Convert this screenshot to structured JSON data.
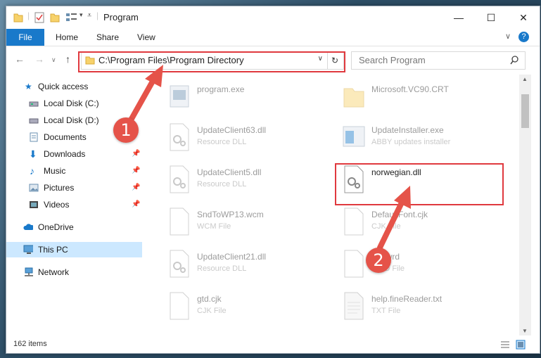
{
  "window": {
    "title": "Program"
  },
  "ribbon": {
    "tabs": [
      "File",
      "Home",
      "Share",
      "View"
    ]
  },
  "address": {
    "path": "C:\\Program Files\\Program Directory"
  },
  "search": {
    "placeholder": "Search Program"
  },
  "sidebar": {
    "items": [
      {
        "label": "Quick access",
        "icon": "star-icon"
      },
      {
        "label": "Local Disk (C:)",
        "icon": "drive-icon"
      },
      {
        "label": "Local Disk (D:)",
        "icon": "drive-icon"
      },
      {
        "label": "Documents",
        "icon": "documents-icon"
      },
      {
        "label": "Downloads",
        "icon": "download-icon"
      },
      {
        "label": "Music",
        "icon": "music-icon"
      },
      {
        "label": "Pictures",
        "icon": "pictures-icon"
      },
      {
        "label": "Videos",
        "icon": "videos-icon"
      },
      {
        "label": "OneDrive",
        "icon": "cloud-icon"
      },
      {
        "label": "This PC",
        "icon": "computer-icon"
      },
      {
        "label": "Network",
        "icon": "network-icon"
      }
    ]
  },
  "files": [
    {
      "name": "program.exe",
      "type": ""
    },
    {
      "name": "Microsoft.VC90.CRT",
      "type": ""
    },
    {
      "name": "UpdateClient63.dll",
      "type": "Resource DLL"
    },
    {
      "name": "UpdateInstaller.exe",
      "type": "ABBY updates installer"
    },
    {
      "name": "UpdateClient5.dll",
      "type": "Resource DLL"
    },
    {
      "name": "norwegian.dll",
      "type": ""
    },
    {
      "name": "SndToWP13.wcm",
      "type": "WCM File"
    },
    {
      "name": "DefaultFont.cjk",
      "type": "CJK File"
    },
    {
      "name": "UpdateClient21.dll",
      "type": "Resource DLL"
    },
    {
      "name": "Dic.wrd",
      "type": "WRD File"
    },
    {
      "name": "gtd.cjk",
      "type": "CJK File"
    },
    {
      "name": "help.fineReader.txt",
      "type": "TXT File"
    }
  ],
  "status": {
    "count": "162 items"
  },
  "steps": [
    "1",
    "2"
  ],
  "colors": {
    "accent": "#1979ca",
    "highlight": "#e0393e",
    "selection": "#cce8ff"
  }
}
